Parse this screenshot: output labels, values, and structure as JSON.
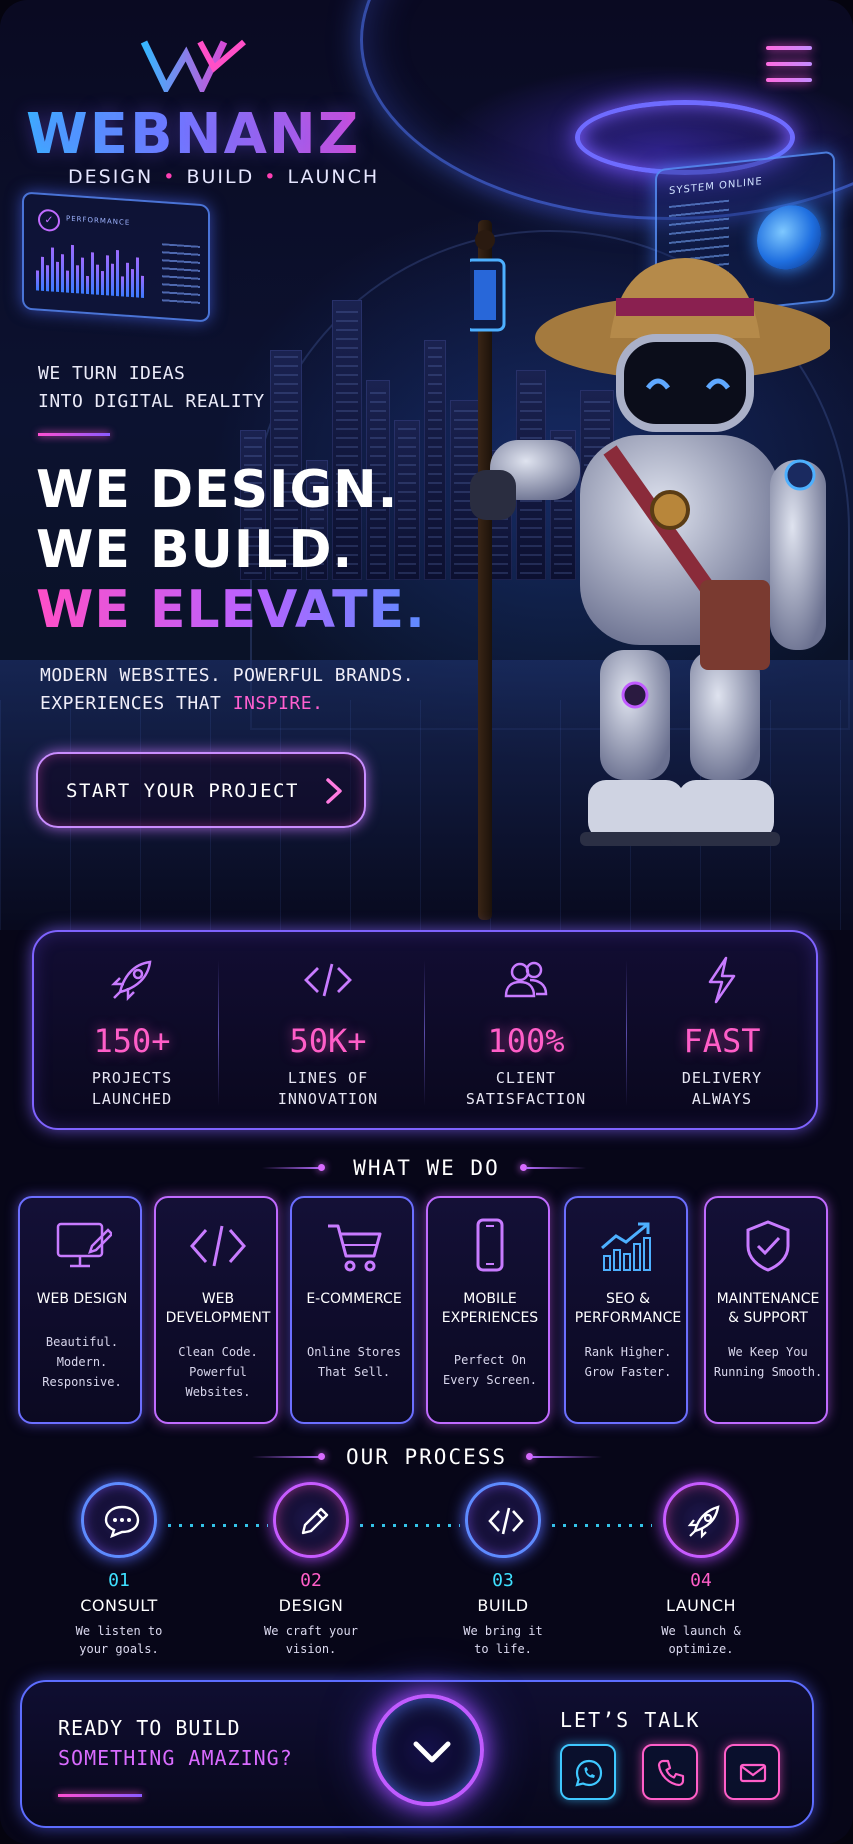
{
  "brand": {
    "name": "WEBNANZ",
    "tagline": [
      "DESIGN",
      "BUILD",
      "LAUNCH"
    ],
    "logo_icon": "w-chevron-logo",
    "colors": {
      "cyan": "#36b6ff",
      "violet": "#6f7dff",
      "magenta": "#ff4fc7"
    }
  },
  "header": {
    "menu_icon": "hamburger-menu-icon"
  },
  "hero": {
    "hud_left_label": "PERFORMANCE",
    "hud_right_label": "SYSTEM ONLINE",
    "intro_line1": "WE TURN IDEAS",
    "intro_line2": "INTO DIGITAL REALITY",
    "headline_1": "WE DESIGN.",
    "headline_2": "WE BUILD.",
    "headline_3": "WE ELEVATE.",
    "sub_line1": "MODERN WEBSITES. POWERFUL BRANDS.",
    "sub_line2_prefix": "EXPERIENCES THAT ",
    "sub_line2_accent": "INSPIRE.",
    "cta_label": "START YOUR PROJECT"
  },
  "stats": [
    {
      "icon": "rocket-icon",
      "value": "150+",
      "line1": "PROJECTS",
      "line2": "LAUNCHED"
    },
    {
      "icon": "code-icon",
      "value": "50K+",
      "line1": "LINES OF",
      "line2": "INNOVATION"
    },
    {
      "icon": "users-icon",
      "value": "100%",
      "line1": "CLIENT",
      "line2": "SATISFACTION"
    },
    {
      "icon": "lightning-icon",
      "value": "FAST",
      "line1": "DELIVERY",
      "line2": "ALWAYS"
    }
  ],
  "services_section": {
    "title": "WHAT WE DO",
    "items": [
      {
        "icon": "monitor-pen-icon",
        "title_1": "WEB DESIGN",
        "title_2": "",
        "desc": [
          "Beautiful.",
          "Modern.",
          "Responsive."
        ]
      },
      {
        "icon": "code-icon",
        "title_1": "WEB",
        "title_2": "DEVELOPMENT",
        "desc": [
          "Clean Code.",
          "Powerful",
          "Websites."
        ]
      },
      {
        "icon": "cart-icon",
        "title_1": "E-COMMERCE",
        "title_2": "",
        "desc": [
          "Online Stores",
          "That Sell."
        ]
      },
      {
        "icon": "phone-icon",
        "title_1": "MOBILE",
        "title_2": "EXPERIENCES",
        "desc": [
          "Perfect On",
          "Every Screen."
        ]
      },
      {
        "icon": "chart-up-icon",
        "title_1": "SEO &",
        "title_2": "PERFORMANCE",
        "desc": [
          "Rank Higher.",
          "Grow Faster."
        ]
      },
      {
        "icon": "shield-check-icon",
        "title_1": "MAINTENANCE",
        "title_2": "& SUPPORT",
        "desc": [
          "We Keep You",
          "Running Smooth."
        ]
      }
    ]
  },
  "process_section": {
    "title": "OUR PROCESS",
    "steps": [
      {
        "icon": "chat-icon",
        "num": "01",
        "title": "CONSULT",
        "desc": [
          "We listen to",
          "your goals."
        ]
      },
      {
        "icon": "pencil-icon",
        "num": "02",
        "title": "DESIGN",
        "desc": [
          "We craft your",
          "vision."
        ]
      },
      {
        "icon": "code-icon",
        "num": "03",
        "title": "BUILD",
        "desc": [
          "We bring it",
          "to life."
        ]
      },
      {
        "icon": "rocket-icon",
        "num": "04",
        "title": "LAUNCH",
        "desc": [
          "We launch &",
          "optimize."
        ]
      }
    ]
  },
  "footer_cta": {
    "line1": "READY TO BUILD",
    "line2": "SOMETHING AMAZING?",
    "orb_icon": "chevron-down-icon",
    "contact_title": "LET’S TALK",
    "contacts": [
      {
        "icon": "whatsapp-icon"
      },
      {
        "icon": "phone-icon"
      },
      {
        "icon": "mail-icon"
      }
    ]
  }
}
